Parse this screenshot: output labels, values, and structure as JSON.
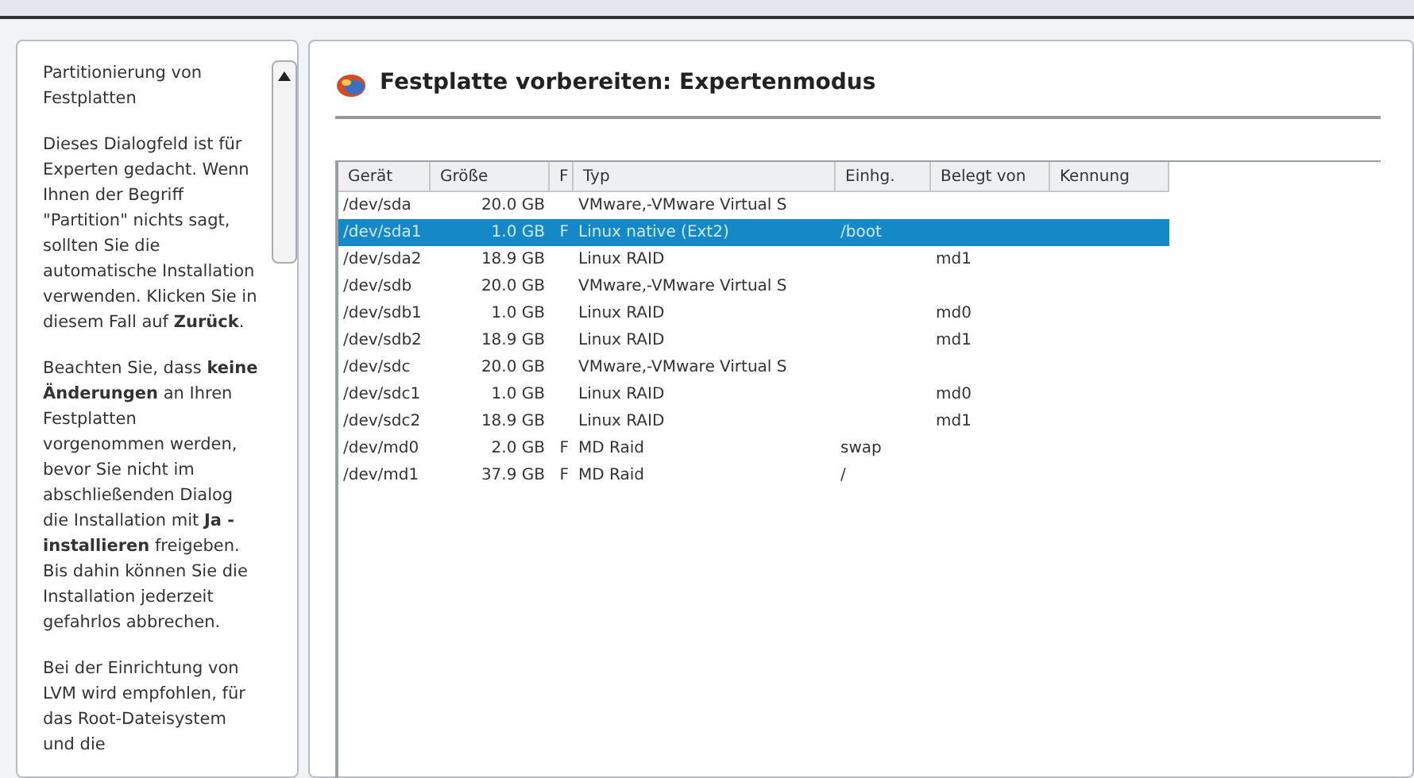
{
  "help": {
    "paragraphs": [
      "Partitionierung von Festplatten",
      "Dieses Dialogfeld ist für Experten gedacht. Wenn Ihnen der Begriff \"Partition\" nichts sagt, sollten Sie die automatische Installation verwenden. Klicken Sie in diesem Fall auf **Zurück**.",
      "Beachten Sie, dass **keine Änderungen** an Ihren Festplatten vorgenommen werden, bevor Sie nicht im abschließenden Dialog die Installation mit **Ja - installieren** freigeben. Bis dahin können Sie die Installation jederzeit gefahrlos abbrechen.",
      "Bei der Einrichtung von LVM wird empfohlen, für das Root-Dateisystem und die"
    ]
  },
  "title": "Festplatte vorbereiten: Expertenmodus",
  "table": {
    "columns": [
      "Gerät",
      "Größe",
      "F",
      "Typ",
      "Einhg.",
      "Belegt von",
      "Kennung"
    ],
    "rows": [
      {
        "device": "/dev/sda",
        "size": "20.0 GB",
        "type": "VMware,-VMware Virtual S",
        "selected": false
      },
      {
        "device": "/dev/sda1",
        "size": "1.0 GB",
        "f": "F",
        "type": "Linux native (Ext2)",
        "mount": "/boot",
        "selected": true
      },
      {
        "device": "/dev/sda2",
        "size": "18.9 GB",
        "type": "Linux RAID",
        "used_by": "md1",
        "selected": false
      },
      {
        "device": "/dev/sdb",
        "size": "20.0 GB",
        "type": "VMware,-VMware Virtual S",
        "selected": false
      },
      {
        "device": "/dev/sdb1",
        "size": "1.0 GB",
        "type": "Linux RAID",
        "used_by": "md0",
        "selected": false
      },
      {
        "device": "/dev/sdb2",
        "size": "18.9 GB",
        "type": "Linux RAID",
        "used_by": "md1",
        "selected": false
      },
      {
        "device": "/dev/sdc",
        "size": "20.0 GB",
        "type": "VMware,-VMware Virtual S",
        "selected": false
      },
      {
        "device": "/dev/sdc1",
        "size": "1.0 GB",
        "type": "Linux RAID",
        "used_by": "md0",
        "selected": false
      },
      {
        "device": "/dev/sdc2",
        "size": "18.9 GB",
        "type": "Linux RAID",
        "used_by": "md1",
        "selected": false
      },
      {
        "device": "/dev/md0",
        "size": "2.0 GB",
        "f": "F",
        "type": "MD Raid",
        "mount": "swap",
        "selected": false
      },
      {
        "device": "/dev/md1",
        "size": "37.9 GB",
        "f": "F",
        "type": "MD Raid",
        "mount": "/",
        "selected": false
      }
    ]
  }
}
